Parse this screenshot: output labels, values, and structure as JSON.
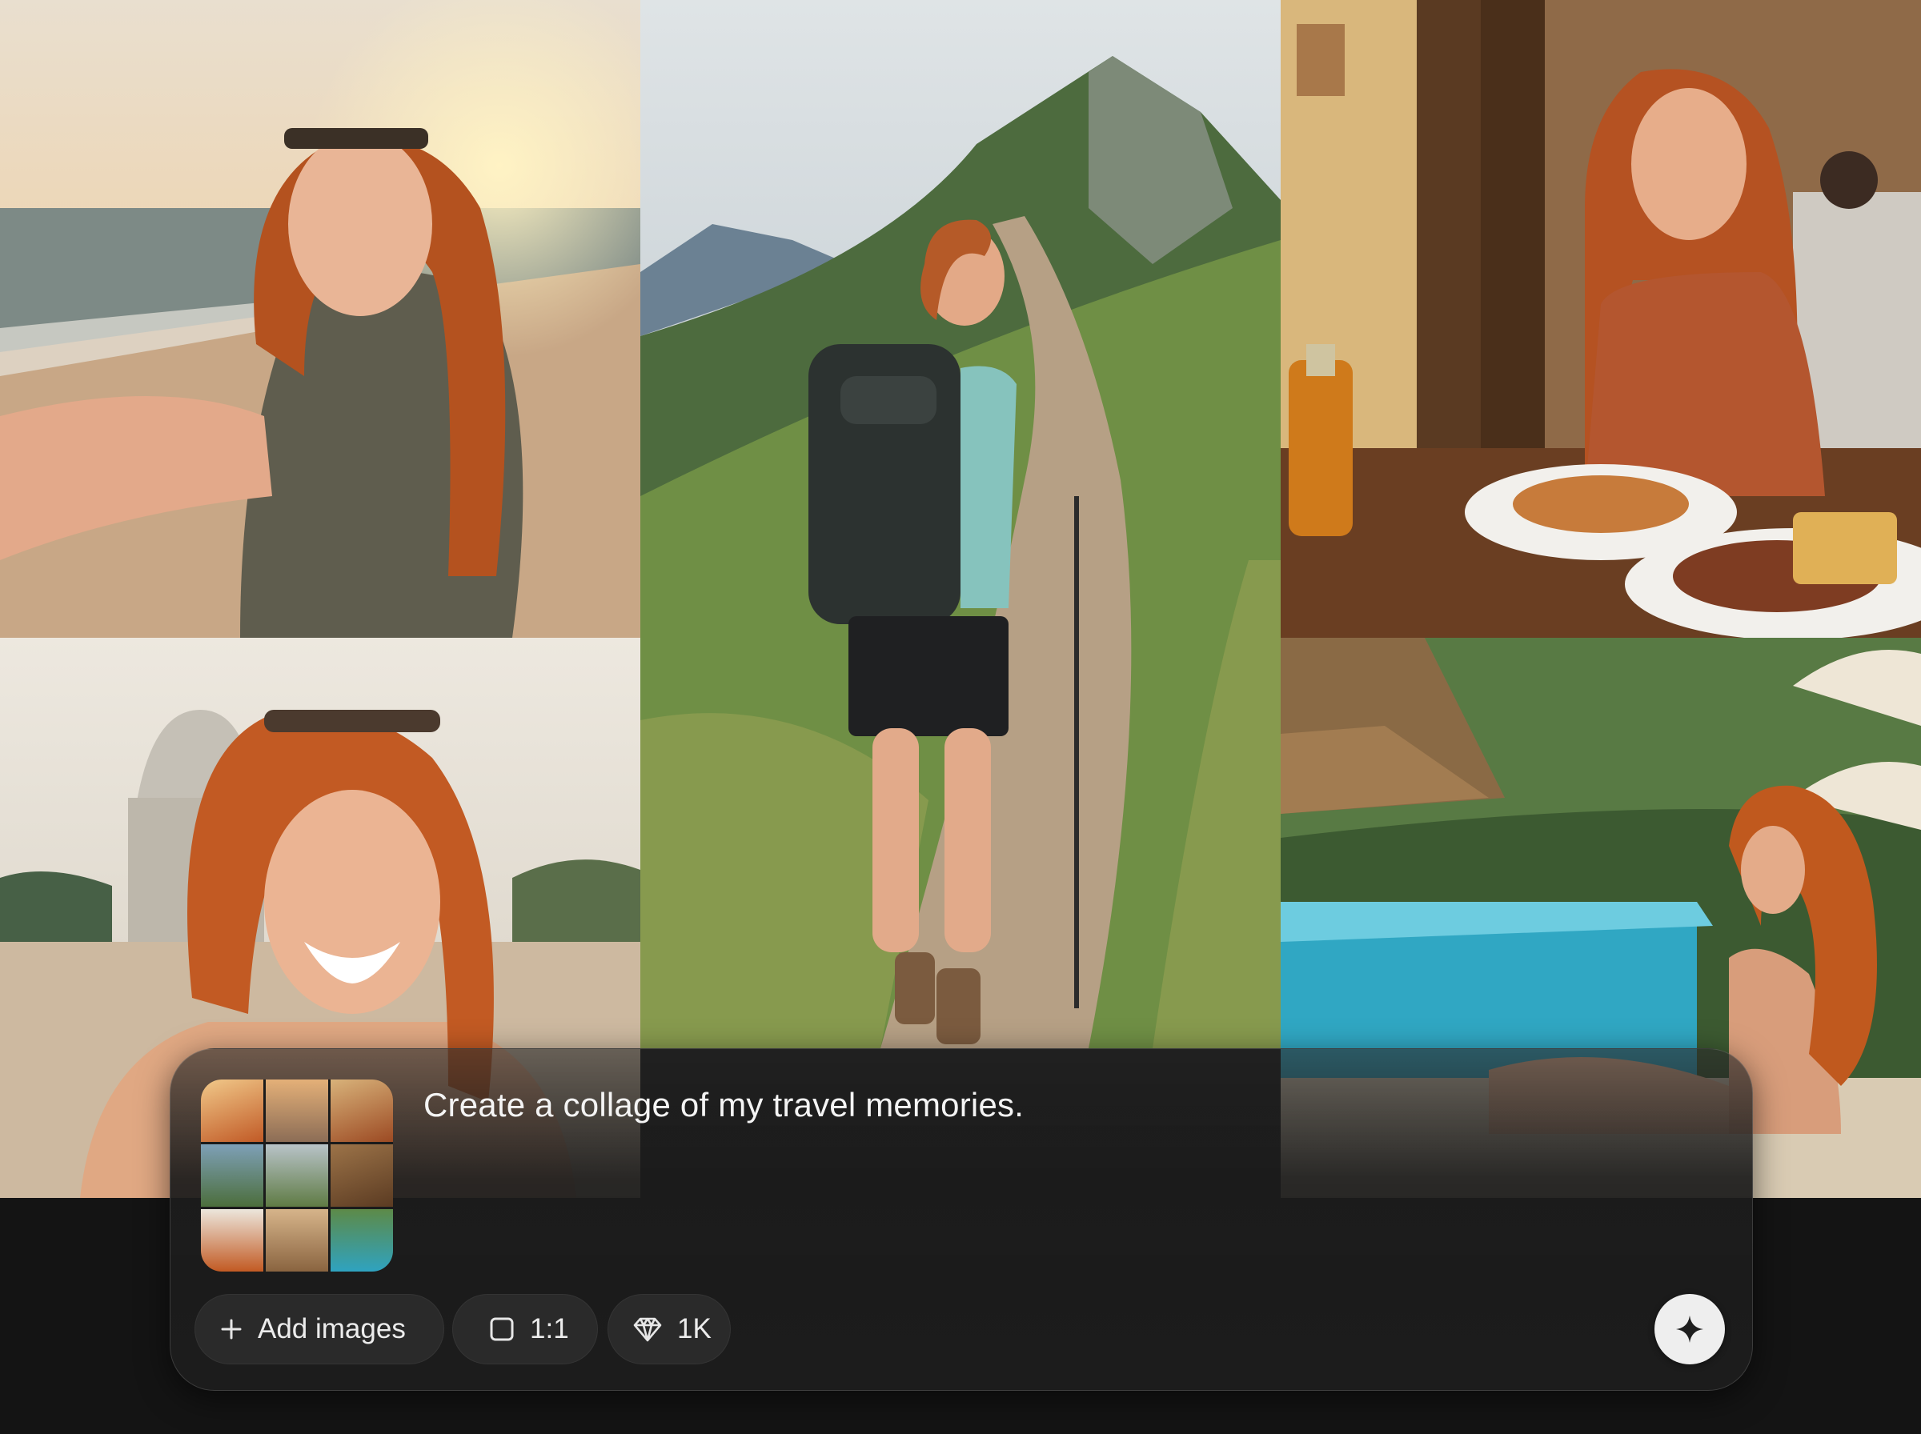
{
  "composer": {
    "prompt_text": "Create a collage of my travel memories.",
    "add_images_label": "Add images",
    "aspect_ratio_label": "1:1",
    "resolution_label": "1K"
  },
  "icons": {
    "add": "plus-icon",
    "aspect": "square-icon",
    "resolution": "diamond-icon",
    "send": "sparkle-icon"
  },
  "colors": {
    "send_button": "#eeeeee",
    "panel_bg": "#1c1c1c",
    "chip_bg": "#2a2a2a"
  }
}
